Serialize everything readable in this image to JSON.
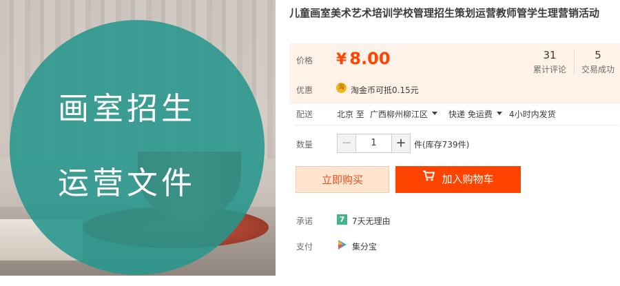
{
  "product_image": {
    "overlay_text_line1": "画室招生",
    "overlay_text_line2": "运营文件",
    "overlay_color": "#26968c"
  },
  "title": "儿童画室美术艺术培训学校管理招生策划运营教师管学生理营销活动",
  "price": {
    "label": "价格",
    "currency_symbol": "¥",
    "value": "8.00",
    "color": "#ff4400"
  },
  "stats": {
    "reviews_count": "31",
    "reviews_label": "累计评论",
    "deals_count": "5",
    "deals_label": "交易成功"
  },
  "promotion": {
    "label": "优惠",
    "icon_char": "淘",
    "text": "淘金币可抵0.15元"
  },
  "shipping": {
    "label": "配送",
    "from": "北京 至",
    "to": "广西柳州柳江区",
    "method": "快递 免运费",
    "time": "4小时内发货"
  },
  "quantity": {
    "label": "数量",
    "minus": "−",
    "value": "1",
    "plus": "+",
    "stock": "件(库存739件)"
  },
  "actions": {
    "buy_now": "立即购买",
    "add_to_cart": "加入购物车"
  },
  "promise": {
    "label": "承诺",
    "badge": "7",
    "text": "7天无理由"
  },
  "payment": {
    "label": "支付",
    "text": "集分宝"
  }
}
